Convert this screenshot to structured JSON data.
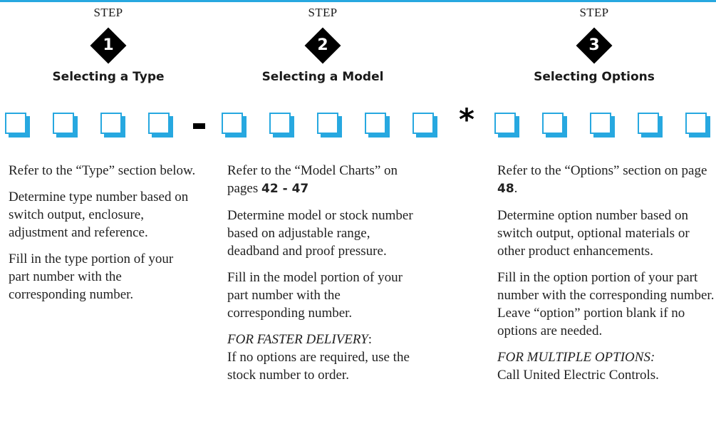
{
  "steps": [
    {
      "label": "STEP",
      "number": "1",
      "title": "Selecting a Type"
    },
    {
      "label": "STEP",
      "number": "2",
      "title": "Selecting a Model"
    },
    {
      "label": "STEP",
      "number": "3",
      "title": "Selecting Options"
    }
  ],
  "separators": {
    "dash": "-",
    "star": "*"
  },
  "columns": {
    "type": {
      "p1": "Refer to the “Type” section below.",
      "p2": "Determine type number based on switch output, enclosure, adjustment and reference.",
      "p3": "Fill in the type portion of your part number with the corresponding number."
    },
    "model": {
      "p1_text": "Refer to the “Model Charts” on pages ",
      "p1_pages": "42 - 47",
      "p2": "Determine model or stock number based on adjustable range, deadband and proof pressure.",
      "p3": "Fill in the model portion of your part number with the corresponding number.",
      "note_label": "FOR FASTER DELIVERY",
      "note_colon": ":",
      "note_text": "If  no options are required, use the stock number to order."
    },
    "options": {
      "p1_text": "Refer to the “Options” section on page ",
      "p1_page": "48",
      "p1_end": ".",
      "p2": "Determine option number based on switch output, optional materials or other product enhancements.",
      "p3": "Fill in the option portion of your part number with the corresponding number.",
      "p3b": "Leave “option” portion blank if no options are needed.",
      "note_label": "FOR MULTIPLE OPTIONS:",
      "note_text": "Call United Electric Controls."
    }
  },
  "colors": {
    "accent": "#27a8e0",
    "diamond": "#000000"
  }
}
